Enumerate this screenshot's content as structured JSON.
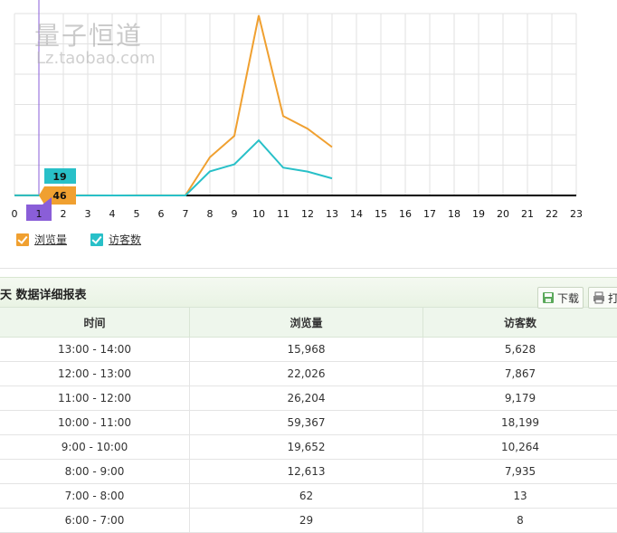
{
  "chart_data": {
    "type": "line",
    "x": [
      0,
      1,
      2,
      3,
      4,
      5,
      6,
      7,
      8,
      9,
      10,
      11,
      12,
      13
    ],
    "x_ticks": [
      "0",
      "1",
      "2",
      "3",
      "4",
      "5",
      "6",
      "7",
      "8",
      "9",
      "10",
      "11",
      "12",
      "13",
      "14",
      "15",
      "16",
      "17",
      "18",
      "19",
      "20",
      "21",
      "22",
      "23"
    ],
    "xlim": [
      0,
      23
    ],
    "ylim": [
      0,
      60000
    ],
    "grid": true,
    "series": [
      {
        "name": "浏览量",
        "color": "#f0a030",
        "values": [
          50,
          46,
          29,
          20,
          15,
          20,
          29,
          62,
          12613,
          19652,
          59367,
          26204,
          22026,
          15968
        ]
      },
      {
        "name": "访客数",
        "color": "#28c0c8",
        "values": [
          20,
          19,
          8,
          6,
          5,
          6,
          8,
          13,
          7935,
          10264,
          18199,
          9179,
          7867,
          5628
        ]
      }
    ],
    "tooltip": {
      "x_label": "1",
      "values": [
        "19",
        "46"
      ]
    },
    "legend_position": "bottom-left"
  },
  "legend": {
    "items": [
      {
        "label": "浏览量",
        "color": "#f0a030"
      },
      {
        "label": "访客数",
        "color": "#28c0c8"
      }
    ]
  },
  "watermark": {
    "line1": "量子恒道",
    "line2": "Lz.taobao.com"
  },
  "report": {
    "title": "天 数据详细报表",
    "download_label": "下载",
    "print_label": "打",
    "columns": [
      "时间",
      "浏览量",
      "访客数"
    ],
    "rows": [
      [
        "13:00 - 14:00",
        "15,968",
        "5,628"
      ],
      [
        "12:00 - 13:00",
        "22,026",
        "7,867"
      ],
      [
        "11:00 - 12:00",
        "26,204",
        "9,179"
      ],
      [
        "10:00 - 11:00",
        "59,367",
        "18,199"
      ],
      [
        "9:00 - 10:00",
        "19,652",
        "10,264"
      ],
      [
        "8:00 - 9:00",
        "12,613",
        "7,935"
      ],
      [
        "7:00 - 8:00",
        "62",
        "13"
      ],
      [
        "6:00 - 7:00",
        "29",
        "8"
      ]
    ]
  }
}
